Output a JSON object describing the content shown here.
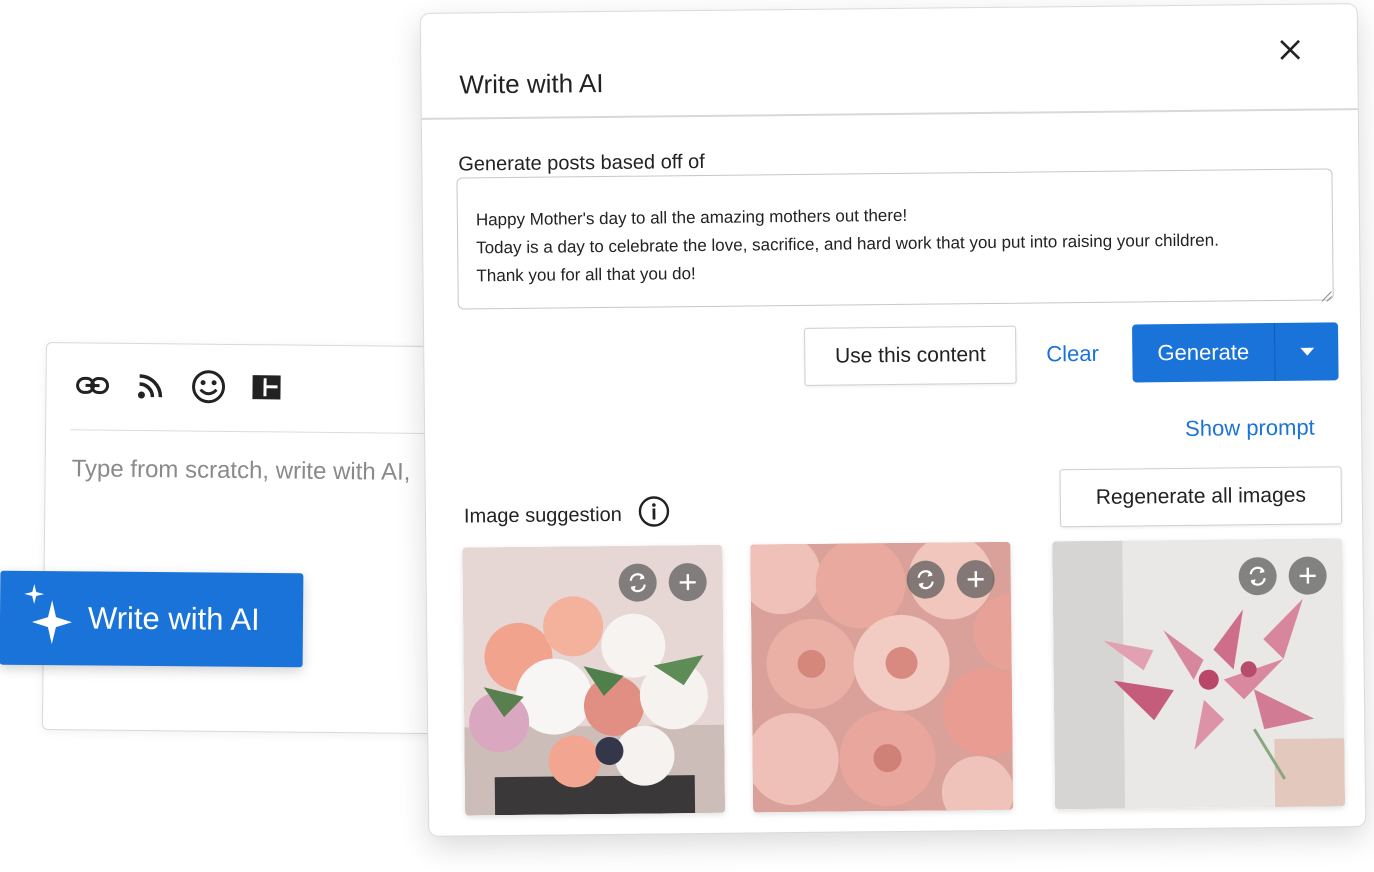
{
  "editor": {
    "toolbar": [
      "link-icon",
      "rss-icon",
      "emoji-icon",
      "layout-icon"
    ],
    "placeholder": "Type from scratch, write with AI,",
    "ai_button_label": "Write with AI"
  },
  "dialog": {
    "title": "Write with AI",
    "close_icon": "close-icon",
    "source_label": "Generate posts based off of",
    "source_text": "Happy Mother's day to all the amazing mothers out there!\nToday is a day to celebrate the love, sacrifice, and hard work that you put into raising your children.\nThank you for all that you do!",
    "use_content_label": "Use this content",
    "clear_label": "Clear",
    "generate_label": "Generate",
    "show_prompt_label": "Show prompt",
    "image_suggestion_label": "Image suggestion",
    "regenerate_all_label": "Regenerate all images",
    "images": [
      {
        "subject": "mixed ranunculus bouquet",
        "colors": [
          "#e7d8d8",
          "#f2a48f",
          "#f7f4f2",
          "#5f8c5a"
        ]
      },
      {
        "subject": "pink ranunculus closeup",
        "colors": [
          "#efc4bb",
          "#e8998e",
          "#c98277",
          "#8b6a60"
        ]
      },
      {
        "subject": "pink alstroemeria",
        "colors": [
          "#f0efef",
          "#d98da4",
          "#c0567a",
          "#dedad6"
        ]
      }
    ]
  },
  "colors": {
    "accent": "#1a73d9",
    "text": "#222222",
    "muted": "#8a8a8a"
  }
}
